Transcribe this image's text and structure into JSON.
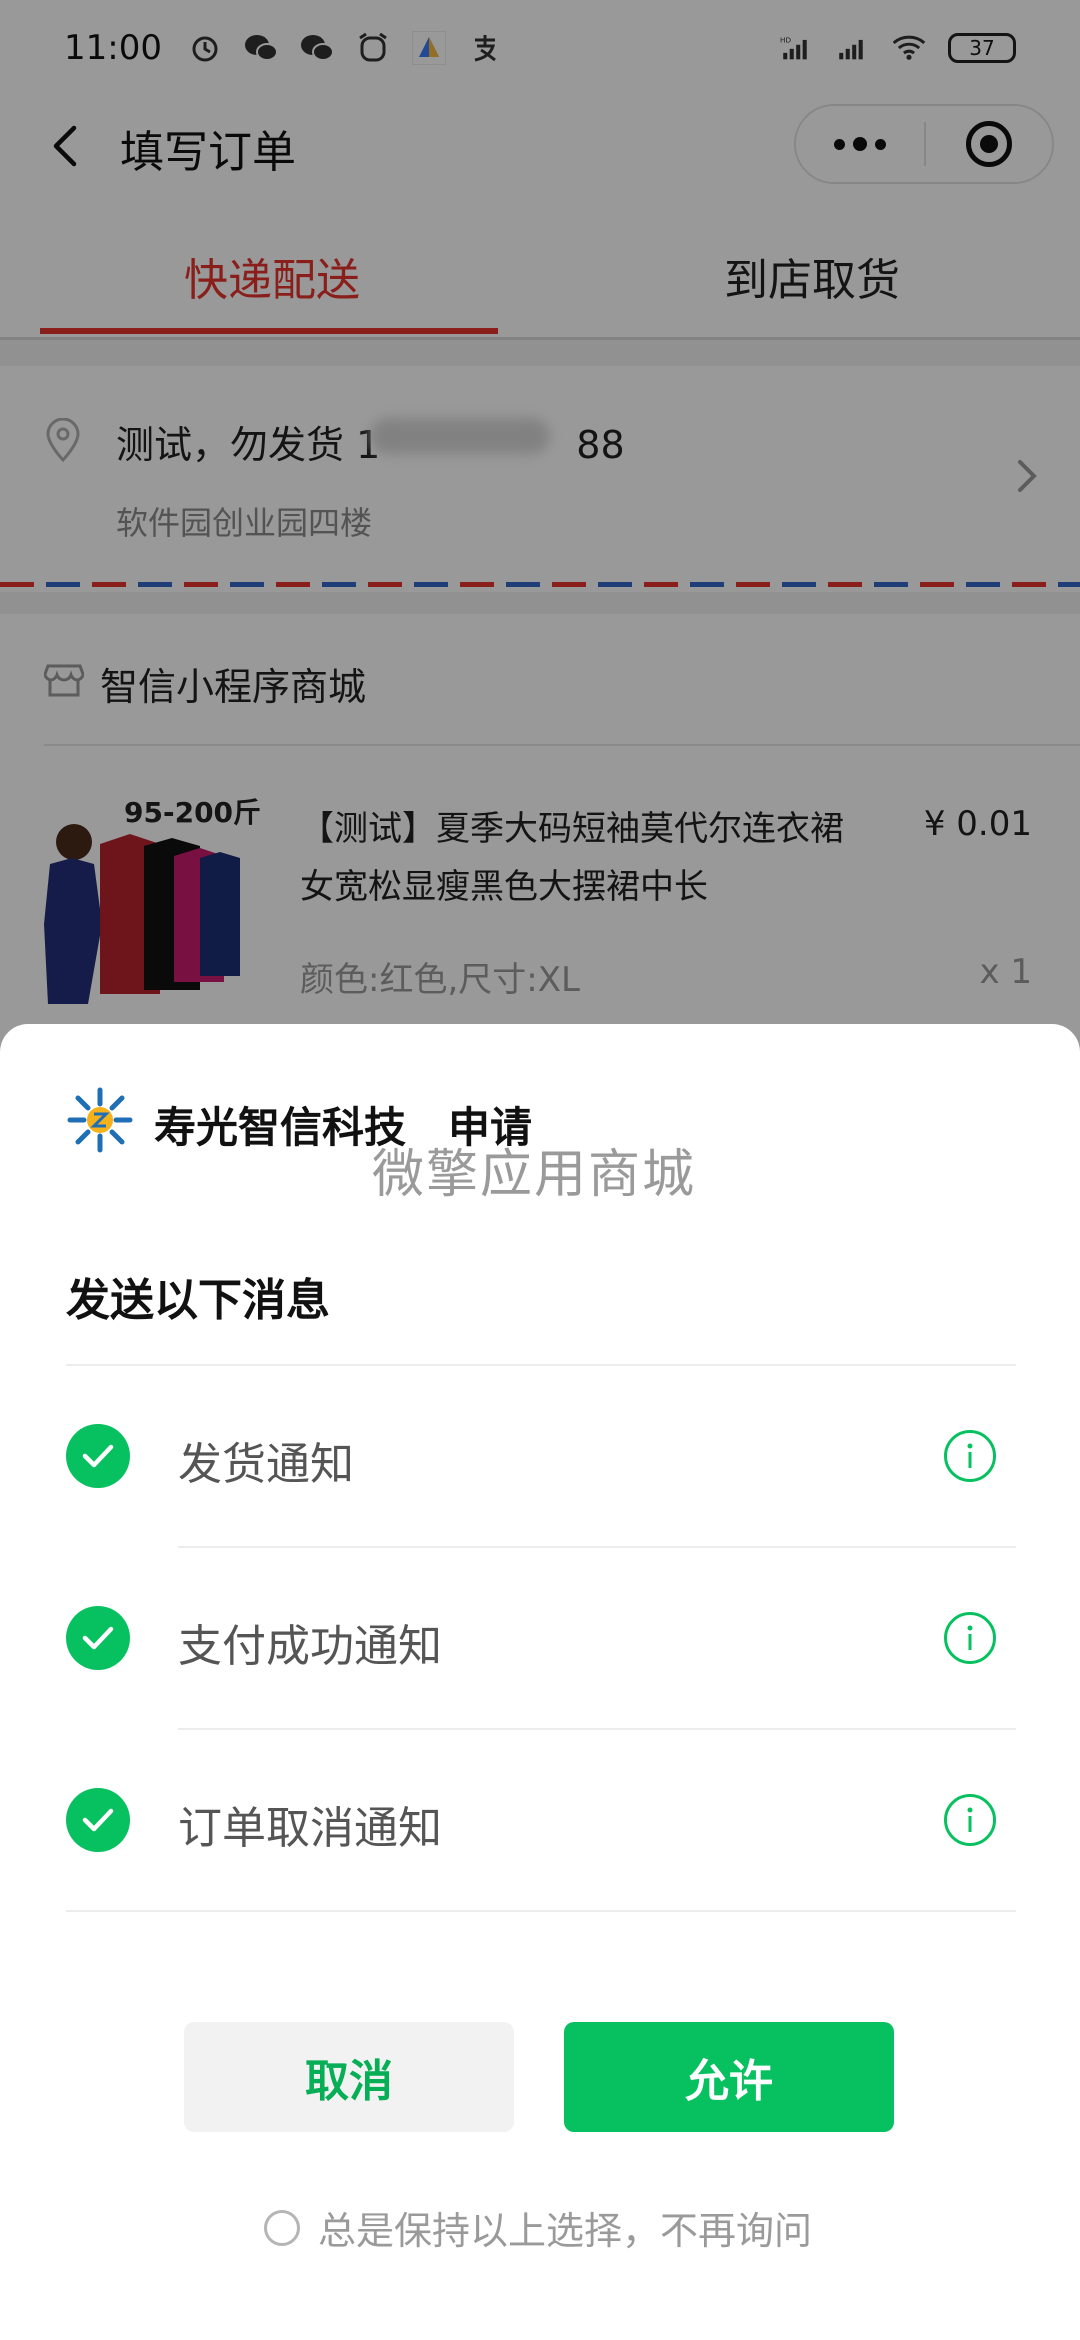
{
  "status_bar": {
    "time": "11:00",
    "battery": "37",
    "network": "HD"
  },
  "nav": {
    "title": "填写订单"
  },
  "tabs": [
    {
      "label": "快递配送",
      "active": true
    },
    {
      "label": "到店取货",
      "active": false
    }
  ],
  "address": {
    "name_phone": "测试，勿发货 1",
    "phone_tail": "88",
    "detail": "软件园创业园四楼"
  },
  "shop": {
    "name": "智信小程序商城"
  },
  "product": {
    "image_text": "95-200斤",
    "title": "【测试】夏季大码短袖莫代尔连衣裙女宽松显瘦黑色大摆裙中长",
    "price": "¥ 0.01",
    "spec": "颜色:红色,尺寸:XL",
    "quantity": "x 1"
  },
  "sheet": {
    "app_name": "寿光智信科技",
    "request_label": "申请",
    "watermark": "微擎应用商城",
    "heading": "发送以下消息",
    "permissions": [
      {
        "label": "发货通知",
        "checked": true
      },
      {
        "label": "支付成功通知",
        "checked": true
      },
      {
        "label": "订单取消通知",
        "checked": true
      }
    ],
    "cancel_label": "取消",
    "allow_label": "允许",
    "remember_label": "总是保持以上选择，不再询问"
  },
  "colors": {
    "brand_green": "#07c160",
    "active_red": "#e5322d"
  }
}
